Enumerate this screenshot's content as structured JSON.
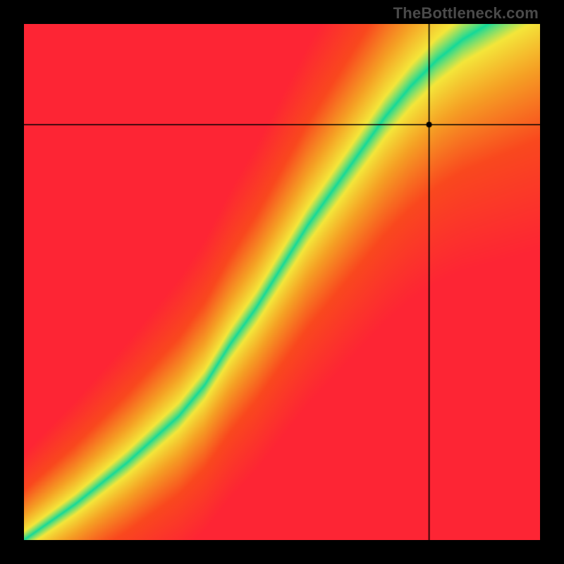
{
  "watermark": "TheBottleneck.com",
  "chart_data": {
    "type": "heatmap",
    "title": "",
    "xlabel": "",
    "ylabel": "",
    "xlim": [
      0,
      1
    ],
    "ylim": [
      0,
      1
    ],
    "crosshair": {
      "x": 0.785,
      "y": 0.805
    },
    "marker": {
      "x": 0.785,
      "y": 0.805,
      "radius": 4,
      "color": "#000000"
    },
    "ridge": {
      "comment": "approximate (x,y) path of the green optimum band center, in plot-normalized 0..1 coords (origin bottom-left)",
      "points": [
        [
          0.0,
          0.0
        ],
        [
          0.1,
          0.07
        ],
        [
          0.2,
          0.15
        ],
        [
          0.3,
          0.24
        ],
        [
          0.35,
          0.3
        ],
        [
          0.4,
          0.38
        ],
        [
          0.45,
          0.45
        ],
        [
          0.5,
          0.53
        ],
        [
          0.55,
          0.61
        ],
        [
          0.6,
          0.68
        ],
        [
          0.65,
          0.75
        ],
        [
          0.7,
          0.82
        ],
        [
          0.75,
          0.88
        ],
        [
          0.8,
          0.93
        ],
        [
          0.85,
          0.97
        ],
        [
          0.9,
          1.0
        ]
      ]
    },
    "band_halfwidth_base": 0.028,
    "band_halfwidth_growth": 0.055,
    "colors": {
      "optimum": "#11d99a",
      "near": "#f4e63a",
      "mid": "#f59f24",
      "far": "#f9481e",
      "worst": "#fd2534"
    }
  }
}
